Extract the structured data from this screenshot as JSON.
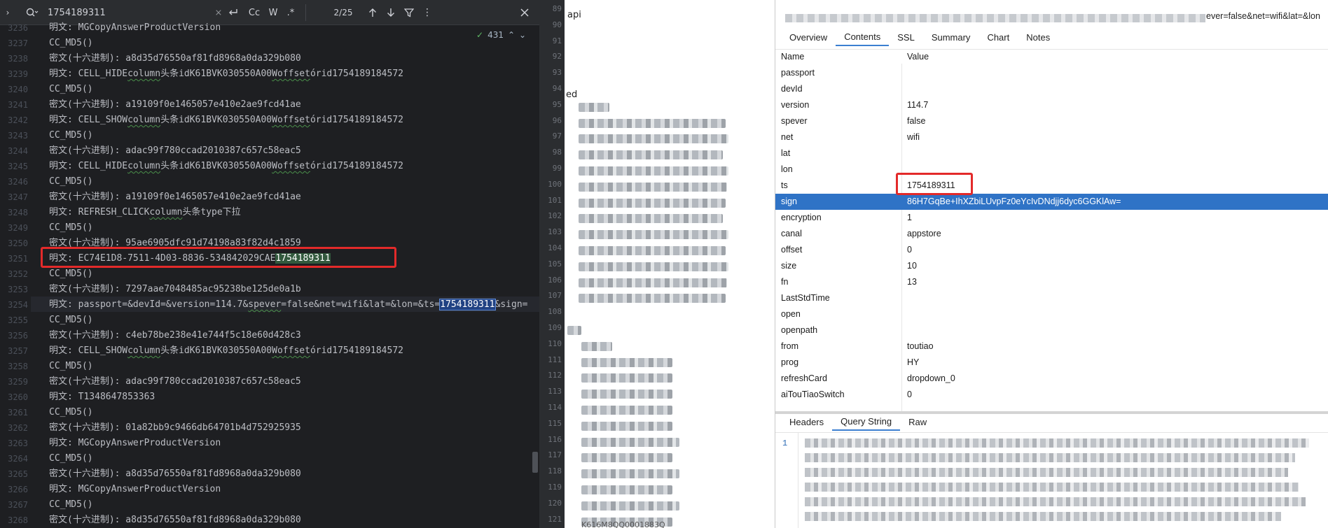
{
  "find_bar": {
    "query": "1754189311",
    "match_count": "2/25",
    "case_label": "Cc",
    "word_label": "W",
    "regex_label": ".*"
  },
  "inspection": {
    "count": "431"
  },
  "editor": {
    "lines": [
      {
        "num": "3236",
        "text": "明文: MGCopyAnswerProductVersion"
      },
      {
        "num": "3237",
        "text": "CC_MD5()"
      },
      {
        "num": "3238",
        "text": "密文(十六进制): a8d35d76550af81fd8968a0da329b080"
      },
      {
        "num": "3239",
        "text": "明文: CELL_HIDEcolumn头条idK61BVK030550A00Woffsetórid1754189184572"
      },
      {
        "num": "3240",
        "text": "CC_MD5()"
      },
      {
        "num": "3241",
        "text": "密文(十六进制): a19109f0e1465057e410e2ae9fcd41ae"
      },
      {
        "num": "3242",
        "text": "明文: CELL_SHOWcolumn头条idK61BVK030550A00Woffsetórid1754189184572"
      },
      {
        "num": "3243",
        "text": "CC_MD5()"
      },
      {
        "num": "3244",
        "text": "密文(十六进制): adac99f780ccad2010387c657c58eac5"
      },
      {
        "num": "3245",
        "text": "明文: CELL_HIDEcolumn头条idK61BVK030550A00Woffsetórid1754189184572"
      },
      {
        "num": "3246",
        "text": "CC_MD5()"
      },
      {
        "num": "3247",
        "text": "密文(十六进制): a19109f0e1465057e410e2ae9fcd41ae"
      },
      {
        "num": "3248",
        "text": "明文: REFRESH_CLICKcolumn头条type下拉"
      },
      {
        "num": "3249",
        "text": "CC_MD5()"
      },
      {
        "num": "3250",
        "text": "密文(十六进制): 95ae6905dfc91d74198a83f82d4c1859"
      },
      {
        "num": "3251",
        "text": "明文: EC74E1D8-7511-4D03-8836-534842029CAE"
      },
      {
        "num": "3252",
        "text": "CC_MD5()"
      },
      {
        "num": "3253",
        "text": "密文(十六进制): 7297aae7048485ac95238be125de0a1b"
      },
      {
        "num": "3254",
        "text": "明文: passport=&devId=&version=114.7&spever=false&net=wifi&lat=&lon=&ts="
      },
      {
        "num": "3255",
        "text": "CC_MD5()"
      },
      {
        "num": "3256",
        "text": "密文(十六进制): c4eb78be238e41e744f5c18e60d428c3"
      },
      {
        "num": "3257",
        "text": "明文: CELL_SHOWcolumn头条idK61BVK030550A00Woffsetórid1754189184572"
      },
      {
        "num": "3258",
        "text": "CC_MD5()"
      },
      {
        "num": "3259",
        "text": "密文(十六进制): adac99f780ccad2010387c657c58eac5"
      },
      {
        "num": "3260",
        "text": "明文: T1348647853363"
      },
      {
        "num": "3261",
        "text": "CC_MD5()"
      },
      {
        "num": "3262",
        "text": "密文(十六进制): 01a82bb9c9466db64701b4d752925935"
      },
      {
        "num": "3263",
        "text": "明文: MGCopyAnswerProductVersion"
      },
      {
        "num": "3264",
        "text": "CC_MD5()"
      },
      {
        "num": "3265",
        "text": "密文(十六进制): a8d35d76550af81fd8968a0da329b080"
      },
      {
        "num": "3266",
        "text": "明文: MGCopyAnswerProductVersion"
      },
      {
        "num": "3267",
        "text": "CC_MD5()"
      },
      {
        "num": "3268",
        "text": "密文(十六进制): a8d35d76550af81fd8968a0da329b080"
      }
    ],
    "match_3251": "1754189311",
    "match_3254": "1754189311",
    "tail_3254": "&sign="
  },
  "middle": {
    "label_api": "api",
    "label_ed": "ed",
    "line_nums": [
      "89",
      "90",
      "91",
      "92",
      "93",
      "94",
      "95",
      "96",
      "97",
      "98",
      "99",
      "100",
      "101",
      "102",
      "103",
      "104",
      "105",
      "106",
      "107",
      "108",
      "109",
      "110",
      "111",
      "112",
      "113",
      "114",
      "115",
      "116",
      "117",
      "118",
      "119",
      "120",
      "121"
    ],
    "bottom_text": "K616M8QQ0001883Q"
  },
  "fiddler": {
    "url_tail": "ever=false&net=wifi&lat=&lon",
    "tabs_top": [
      "Overview",
      "Contents",
      "SSL",
      "Summary",
      "Chart",
      "Notes"
    ],
    "active_top": "Contents",
    "col_name": "Name",
    "col_value": "Value",
    "rows": [
      {
        "k": "passport",
        "v": ""
      },
      {
        "k": "devId",
        "v": ""
      },
      {
        "k": "version",
        "v": "114.7"
      },
      {
        "k": "spever",
        "v": "false"
      },
      {
        "k": "net",
        "v": "wifi"
      },
      {
        "k": "lat",
        "v": ""
      },
      {
        "k": "lon",
        "v": ""
      },
      {
        "k": "ts",
        "v": "1754189311"
      },
      {
        "k": "sign",
        "v": "86H7GqBe+IhXZbiLUvpFz0eYcIvDNdjj6dyc6GGKlAw="
      },
      {
        "k": "encryption",
        "v": "1"
      },
      {
        "k": "canal",
        "v": "appstore"
      },
      {
        "k": "offset",
        "v": "0"
      },
      {
        "k": "size",
        "v": "10"
      },
      {
        "k": "fn",
        "v": "13"
      },
      {
        "k": "LastStdTime",
        "v": ""
      },
      {
        "k": "open",
        "v": ""
      },
      {
        "k": "openpath",
        "v": ""
      },
      {
        "k": "from",
        "v": "toutiao"
      },
      {
        "k": "prog",
        "v": "HY"
      },
      {
        "k": "refreshCard",
        "v": "dropdown_0"
      },
      {
        "k": "aiTouTiaoSwitch",
        "v": "0"
      }
    ],
    "selected_row": "sign",
    "tabs_bottom": [
      "Headers",
      "Query String",
      "Raw"
    ],
    "active_bottom": "Query String",
    "raw_line": "1"
  },
  "colors": {
    "editor_bg": "#1e1f22",
    "match_primary": "#214283",
    "match_secondary": "#32593d",
    "highlight_box": "#e32a2a",
    "grid_selection": "#2f73c6"
  }
}
